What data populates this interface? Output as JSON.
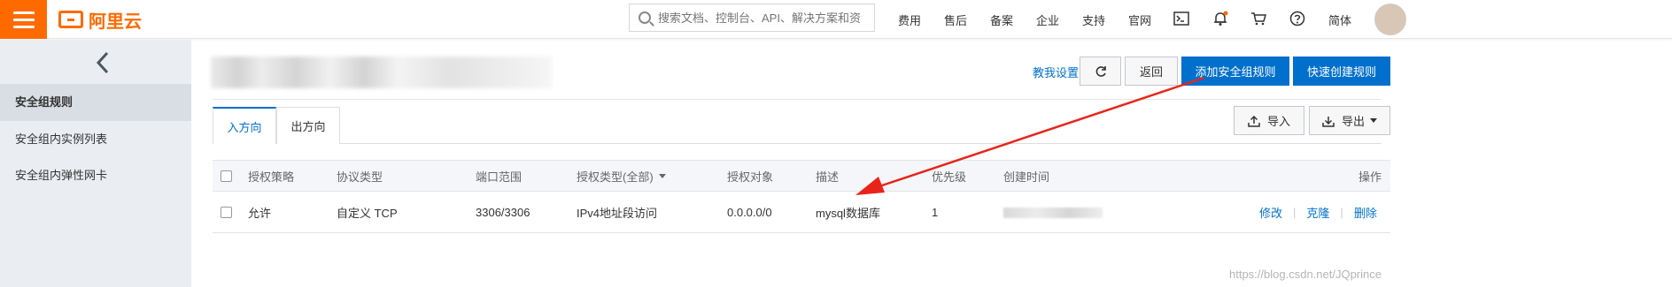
{
  "header": {
    "logo_text": "阿里云",
    "search_placeholder": "搜索文档、控制台、API、解决方案和资源",
    "nav": [
      "费用",
      "售后",
      "备案",
      "企业",
      "支持",
      "官网"
    ],
    "language": "简体",
    "brand_color": "#ff6a00"
  },
  "sidebar": {
    "items": [
      {
        "label": "安全组规则",
        "active": true
      },
      {
        "label": "安全组内实例列表",
        "active": false
      },
      {
        "label": "安全组内弹性网卡",
        "active": false
      }
    ]
  },
  "toolbar": {
    "guide_link": "教我设置",
    "back_label": "返回",
    "add_rule_label": "添加安全组规则",
    "quick_create_label": "快速创建规则",
    "import_label": "导入",
    "export_label": "导出",
    "accent_color": "#0070cc"
  },
  "tabs": [
    {
      "label": "入方向",
      "active": true
    },
    {
      "label": "出方向",
      "active": false
    }
  ],
  "table": {
    "headers": [
      "授权策略",
      "协议类型",
      "端口范围",
      "授权类型(全部)",
      "授权对象",
      "描述",
      "优先级",
      "创建时间",
      "操作"
    ],
    "rows": [
      {
        "policy": "允许",
        "protocol": "自定义 TCP",
        "port_range": "3306/3306",
        "auth_type": "IPv4地址段访问",
        "auth_object": "0.0.0.0/0",
        "description": "mysql数据库",
        "priority": "1",
        "actions": [
          "修改",
          "克隆",
          "删除"
        ]
      }
    ]
  },
  "watermark": "https://blog.csdn.net/JQprince"
}
